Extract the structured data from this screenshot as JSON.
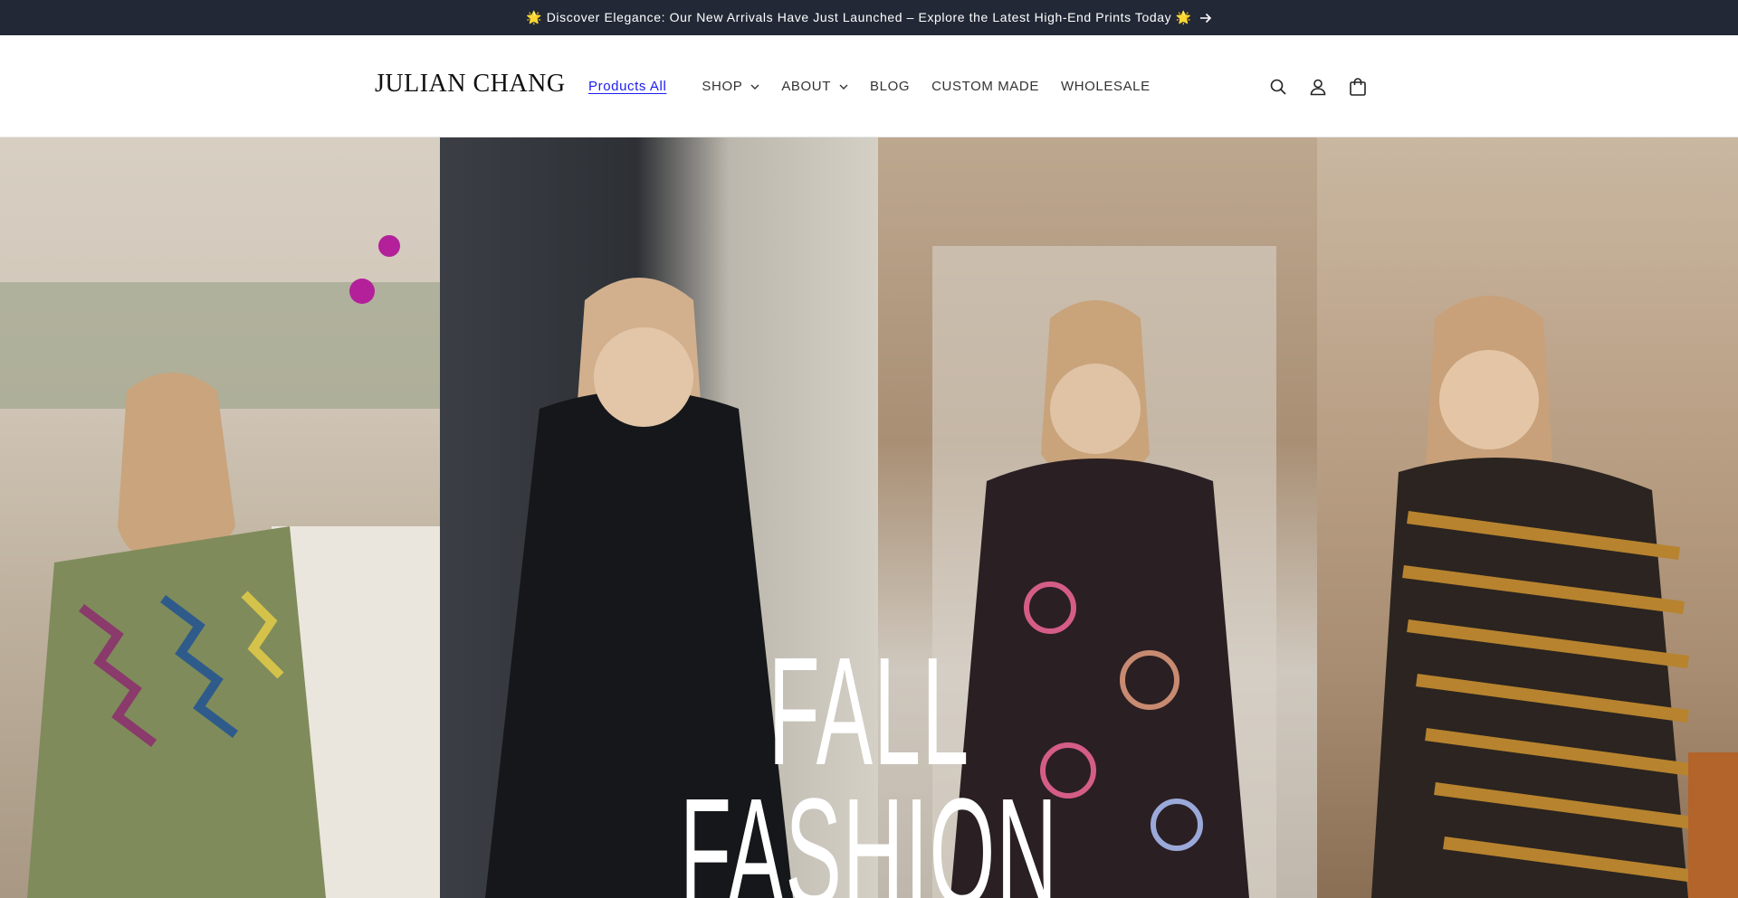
{
  "announcement": {
    "text": "🌟 Discover Elegance: Our New Arrivals Have Just Launched – Explore the Latest High-End Prints Today 🌟"
  },
  "header": {
    "logo": "JULIAN CHANG",
    "nav": {
      "products_all": "Products All",
      "shop": "SHOP",
      "about": "ABOUT",
      "blog": "BLOG",
      "custom_made": "CUSTOM MADE",
      "wholesale": "WHOLESALE"
    },
    "icons": [
      "search-icon",
      "account-icon",
      "cart-icon"
    ]
  },
  "hero": {
    "title_line1": "FALL",
    "title_line2": "FASHION"
  },
  "colors": {
    "announcement_bg": "#222836",
    "link": "#1d1df0",
    "hero_text": "#ffffff"
  }
}
